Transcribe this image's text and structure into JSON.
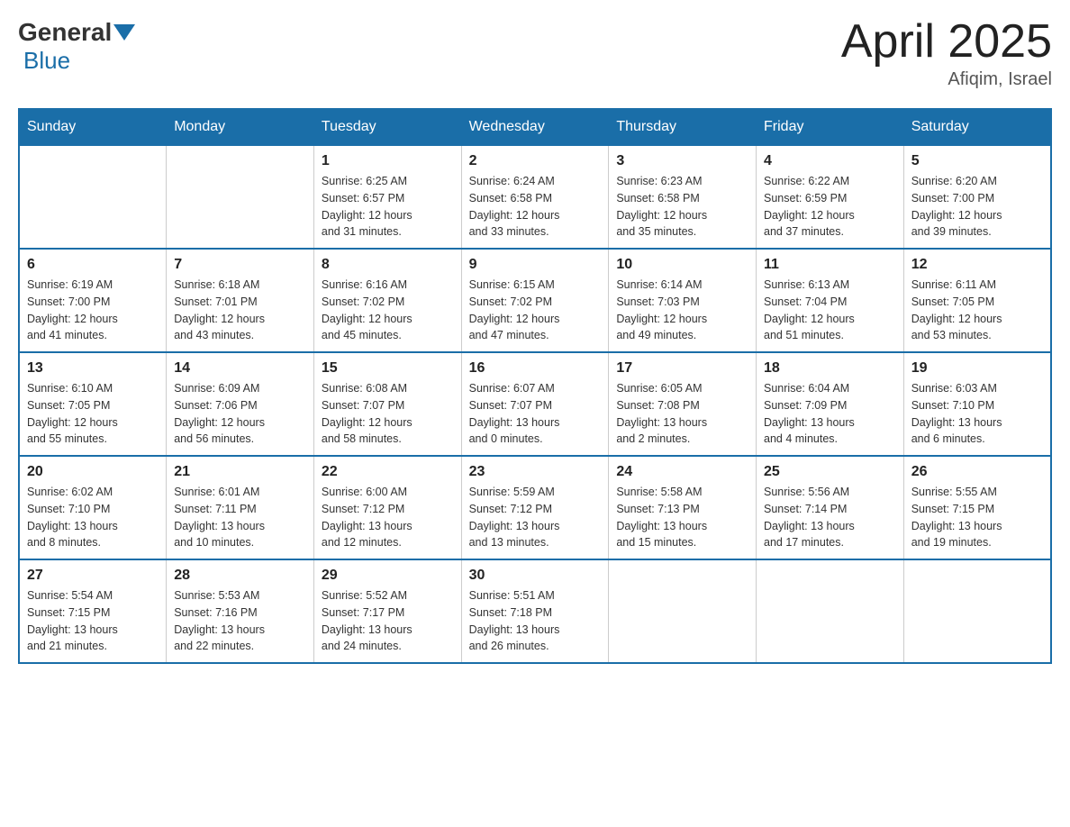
{
  "header": {
    "logo": {
      "general": "General",
      "blue": "Blue"
    },
    "title": "April 2025",
    "location": "Afiqim, Israel"
  },
  "weekdays": [
    "Sunday",
    "Monday",
    "Tuesday",
    "Wednesday",
    "Thursday",
    "Friday",
    "Saturday"
  ],
  "weeks": [
    [
      {
        "day": "",
        "info": ""
      },
      {
        "day": "",
        "info": ""
      },
      {
        "day": "1",
        "info": "Sunrise: 6:25 AM\nSunset: 6:57 PM\nDaylight: 12 hours\nand 31 minutes."
      },
      {
        "day": "2",
        "info": "Sunrise: 6:24 AM\nSunset: 6:58 PM\nDaylight: 12 hours\nand 33 minutes."
      },
      {
        "day": "3",
        "info": "Sunrise: 6:23 AM\nSunset: 6:58 PM\nDaylight: 12 hours\nand 35 minutes."
      },
      {
        "day": "4",
        "info": "Sunrise: 6:22 AM\nSunset: 6:59 PM\nDaylight: 12 hours\nand 37 minutes."
      },
      {
        "day": "5",
        "info": "Sunrise: 6:20 AM\nSunset: 7:00 PM\nDaylight: 12 hours\nand 39 minutes."
      }
    ],
    [
      {
        "day": "6",
        "info": "Sunrise: 6:19 AM\nSunset: 7:00 PM\nDaylight: 12 hours\nand 41 minutes."
      },
      {
        "day": "7",
        "info": "Sunrise: 6:18 AM\nSunset: 7:01 PM\nDaylight: 12 hours\nand 43 minutes."
      },
      {
        "day": "8",
        "info": "Sunrise: 6:16 AM\nSunset: 7:02 PM\nDaylight: 12 hours\nand 45 minutes."
      },
      {
        "day": "9",
        "info": "Sunrise: 6:15 AM\nSunset: 7:02 PM\nDaylight: 12 hours\nand 47 minutes."
      },
      {
        "day": "10",
        "info": "Sunrise: 6:14 AM\nSunset: 7:03 PM\nDaylight: 12 hours\nand 49 minutes."
      },
      {
        "day": "11",
        "info": "Sunrise: 6:13 AM\nSunset: 7:04 PM\nDaylight: 12 hours\nand 51 minutes."
      },
      {
        "day": "12",
        "info": "Sunrise: 6:11 AM\nSunset: 7:05 PM\nDaylight: 12 hours\nand 53 minutes."
      }
    ],
    [
      {
        "day": "13",
        "info": "Sunrise: 6:10 AM\nSunset: 7:05 PM\nDaylight: 12 hours\nand 55 minutes."
      },
      {
        "day": "14",
        "info": "Sunrise: 6:09 AM\nSunset: 7:06 PM\nDaylight: 12 hours\nand 56 minutes."
      },
      {
        "day": "15",
        "info": "Sunrise: 6:08 AM\nSunset: 7:07 PM\nDaylight: 12 hours\nand 58 minutes."
      },
      {
        "day": "16",
        "info": "Sunrise: 6:07 AM\nSunset: 7:07 PM\nDaylight: 13 hours\nand 0 minutes."
      },
      {
        "day": "17",
        "info": "Sunrise: 6:05 AM\nSunset: 7:08 PM\nDaylight: 13 hours\nand 2 minutes."
      },
      {
        "day": "18",
        "info": "Sunrise: 6:04 AM\nSunset: 7:09 PM\nDaylight: 13 hours\nand 4 minutes."
      },
      {
        "day": "19",
        "info": "Sunrise: 6:03 AM\nSunset: 7:10 PM\nDaylight: 13 hours\nand 6 minutes."
      }
    ],
    [
      {
        "day": "20",
        "info": "Sunrise: 6:02 AM\nSunset: 7:10 PM\nDaylight: 13 hours\nand 8 minutes."
      },
      {
        "day": "21",
        "info": "Sunrise: 6:01 AM\nSunset: 7:11 PM\nDaylight: 13 hours\nand 10 minutes."
      },
      {
        "day": "22",
        "info": "Sunrise: 6:00 AM\nSunset: 7:12 PM\nDaylight: 13 hours\nand 12 minutes."
      },
      {
        "day": "23",
        "info": "Sunrise: 5:59 AM\nSunset: 7:12 PM\nDaylight: 13 hours\nand 13 minutes."
      },
      {
        "day": "24",
        "info": "Sunrise: 5:58 AM\nSunset: 7:13 PM\nDaylight: 13 hours\nand 15 minutes."
      },
      {
        "day": "25",
        "info": "Sunrise: 5:56 AM\nSunset: 7:14 PM\nDaylight: 13 hours\nand 17 minutes."
      },
      {
        "day": "26",
        "info": "Sunrise: 5:55 AM\nSunset: 7:15 PM\nDaylight: 13 hours\nand 19 minutes."
      }
    ],
    [
      {
        "day": "27",
        "info": "Sunrise: 5:54 AM\nSunset: 7:15 PM\nDaylight: 13 hours\nand 21 minutes."
      },
      {
        "day": "28",
        "info": "Sunrise: 5:53 AM\nSunset: 7:16 PM\nDaylight: 13 hours\nand 22 minutes."
      },
      {
        "day": "29",
        "info": "Sunrise: 5:52 AM\nSunset: 7:17 PM\nDaylight: 13 hours\nand 24 minutes."
      },
      {
        "day": "30",
        "info": "Sunrise: 5:51 AM\nSunset: 7:18 PM\nDaylight: 13 hours\nand 26 minutes."
      },
      {
        "day": "",
        "info": ""
      },
      {
        "day": "",
        "info": ""
      },
      {
        "day": "",
        "info": ""
      }
    ]
  ]
}
